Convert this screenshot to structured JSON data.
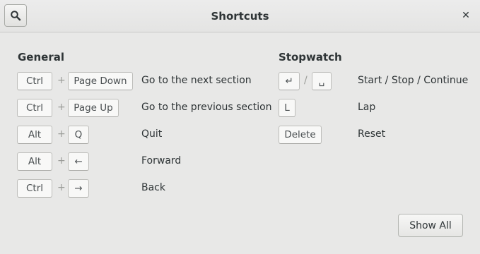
{
  "window": {
    "title": "Shortcuts",
    "search_icon": "search-icon",
    "close_label": "✕",
    "show_all_label": "Show All"
  },
  "general": {
    "title": "General",
    "shortcuts": [
      {
        "keys": [
          "Ctrl",
          "Page Down"
        ],
        "sep": "+",
        "desc": "Go to the next section"
      },
      {
        "keys": [
          "Ctrl",
          "Page Up"
        ],
        "sep": "+",
        "desc": "Go to the previous section"
      },
      {
        "keys": [
          "Alt",
          "Q"
        ],
        "sep": "+",
        "desc": "Quit"
      },
      {
        "keys": [
          "Alt",
          "←"
        ],
        "sep": "+",
        "desc": "Forward"
      },
      {
        "keys": [
          "Ctrl",
          "→"
        ],
        "sep": "+",
        "desc": "Back"
      }
    ]
  },
  "stopwatch": {
    "title": "Stopwatch",
    "shortcuts": [
      {
        "keys": [
          "↵",
          "␣"
        ],
        "sep": "/",
        "desc": "Start / Stop / Continue"
      },
      {
        "keys": [
          "L"
        ],
        "desc": "Lap"
      },
      {
        "keys": [
          "Delete"
        ],
        "desc": "Reset"
      }
    ]
  }
}
